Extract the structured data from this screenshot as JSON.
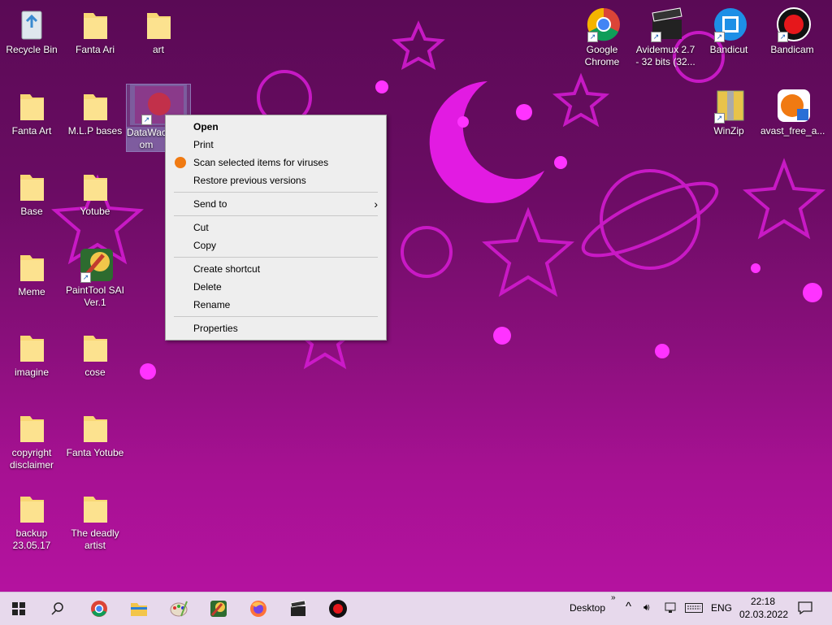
{
  "desktop_icons": [
    {
      "id": "recycle-bin",
      "label": "Recycle Bin",
      "type": "recycle"
    },
    {
      "id": "fanta-ari",
      "label": "Fanta Ari",
      "type": "folder"
    },
    {
      "id": "art",
      "label": "art",
      "type": "folder"
    },
    {
      "id": "fanta-art",
      "label": "Fanta Art",
      "type": "folder"
    },
    {
      "id": "mlp-bases",
      "label": "M.L.P bases",
      "type": "folder"
    },
    {
      "id": "datawac",
      "label": "DataWac om",
      "type": "shortcut-image"
    },
    {
      "id": "base",
      "label": "Base",
      "type": "folder"
    },
    {
      "id": "yotube",
      "label": "Yotube",
      "type": "folder"
    },
    {
      "id": "meme",
      "label": "Meme",
      "type": "folder"
    },
    {
      "id": "painttool",
      "label": "PaintTool SAI Ver.1",
      "type": "app"
    },
    {
      "id": "imagine",
      "label": "imagine",
      "type": "folder"
    },
    {
      "id": "cose",
      "label": "cose",
      "type": "folder"
    },
    {
      "id": "copyright",
      "label": "copyright disclaimer",
      "type": "folder"
    },
    {
      "id": "fanta-yotube",
      "label": "Fanta Yotube",
      "type": "folder"
    },
    {
      "id": "backup",
      "label": "backup 23.05.17",
      "type": "folder"
    },
    {
      "id": "deadly-artist",
      "label": "The deadly artist",
      "type": "folder"
    },
    {
      "id": "google-chrome",
      "label": "Google Chrome",
      "type": "chrome"
    },
    {
      "id": "avidemux",
      "label": "Avidemux 2.7 - 32 bits (32...",
      "type": "clapper"
    },
    {
      "id": "bandicut",
      "label": "Bandicut",
      "type": "bandicut"
    },
    {
      "id": "bandicam",
      "label": "Bandicam",
      "type": "bandicam"
    },
    {
      "id": "winzip",
      "label": "WinZip",
      "type": "winzip"
    },
    {
      "id": "avast",
      "label": "avast_free_a...",
      "type": "avast"
    }
  ],
  "context_menu": {
    "items": [
      {
        "label": "Open",
        "bold": true
      },
      {
        "label": "Print"
      },
      {
        "label": "Scan selected items for viruses",
        "icon": "avast-icon"
      },
      {
        "label": "Restore previous versions"
      },
      {
        "label": "Send to",
        "submenu": true
      },
      {
        "label": "Cut"
      },
      {
        "label": "Copy"
      },
      {
        "label": "Create shortcut"
      },
      {
        "label": "Delete"
      },
      {
        "label": "Rename"
      },
      {
        "label": "Properties"
      }
    ]
  },
  "taskbar": {
    "apps": [
      "start-icon",
      "search-icon",
      "chrome-icon",
      "file-explorer-icon",
      "paint-icon",
      "painttool-icon",
      "firefox-icon",
      "avidemux-icon",
      "bandicam-icon"
    ],
    "desktop_label": "Desktop",
    "language": "ENG",
    "time": "22:18",
    "date": "02.03.2022"
  },
  "colors": {
    "wallpaper": "#8a0f7c",
    "accent": "#ff33ff",
    "taskbar": "#e7d9ec"
  }
}
